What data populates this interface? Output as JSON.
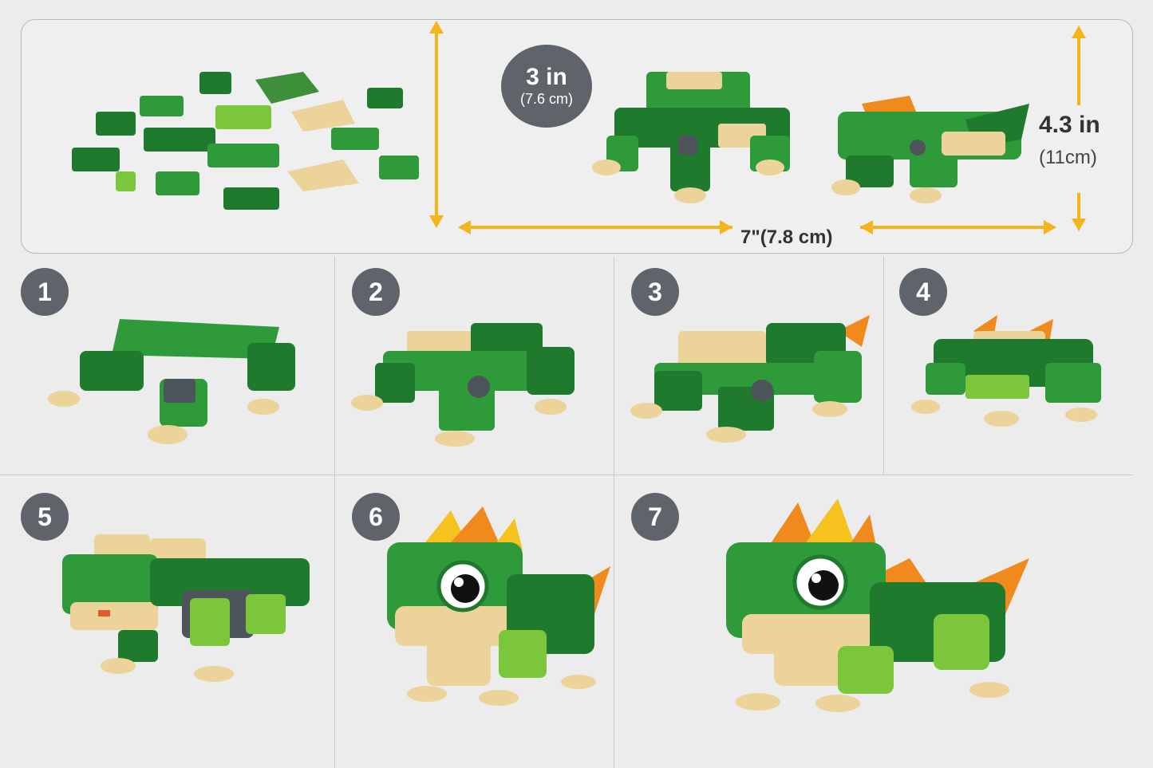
{
  "dimensions": {
    "height_circle": {
      "value": "3 in",
      "sub": "(7.6 cm)"
    },
    "right_height": {
      "value": "4.3 in",
      "sub": "(11cm)"
    },
    "width": {
      "value": "7\"(7.8 cm)"
    }
  },
  "steps": [
    {
      "label": "1"
    },
    {
      "label": "2"
    },
    {
      "label": "3"
    },
    {
      "label": "4"
    },
    {
      "label": "5"
    },
    {
      "label": "6"
    },
    {
      "label": "7"
    }
  ],
  "colors": {
    "dark_green": "#1f7a2e",
    "mid_green": "#2e9a3a",
    "light_green": "#7cc63c",
    "tan": "#ecd39a",
    "orange": "#f08a1c",
    "yellow": "#f5c21e",
    "gray": "#4d555b",
    "arrow": "#f4b41a",
    "badge": "#5e6469"
  },
  "icons": {
    "dimension_arrow": "double-headed-arrow",
    "parts": "brick-parts-pile",
    "models": "lizard-brick-model"
  }
}
